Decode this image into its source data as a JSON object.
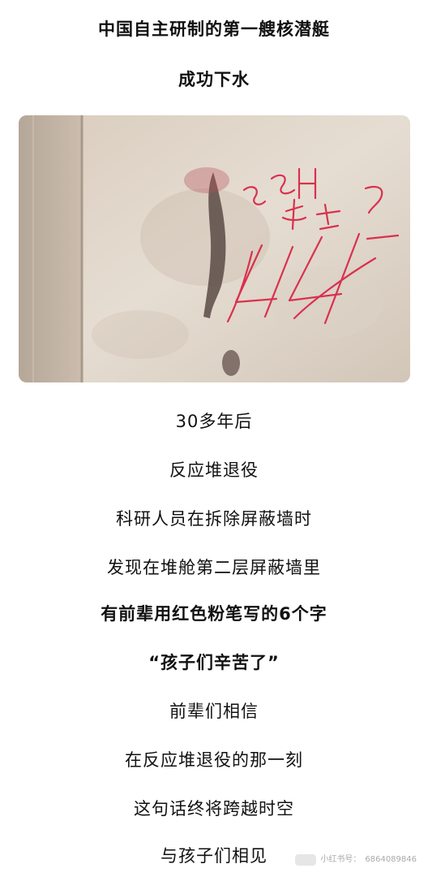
{
  "title_lines": [
    "中国自主研制的第一艘核潜艇",
    "成功下水"
  ],
  "photo": {
    "subject": "wall with red chalk writing",
    "chalk_text": "SH 孩子们辛苦了"
  },
  "body_lines": [
    "30多年后",
    "反应堆退役",
    "科研人员在拆除屏蔽墙时",
    "发现在堆舱第二层屏蔽墙里",
    "有前辈用红色粉笔写的6个字",
    "“孩子们辛苦了”",
    "前辈们相信",
    "在反应堆退役的那一刻",
    "这句话终将跨越时空",
    "与孩子们相见"
  ],
  "watermark": {
    "label": "小红书号：",
    "id": "6864089846"
  }
}
